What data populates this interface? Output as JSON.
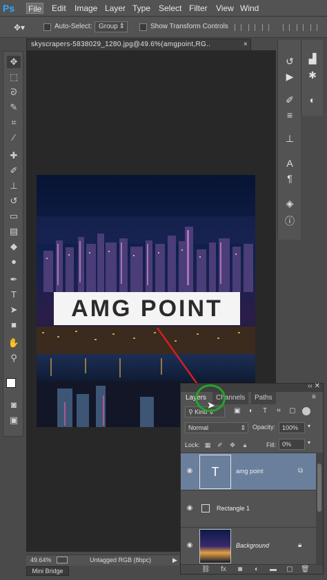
{
  "app": {
    "logo": "Ps"
  },
  "menu": {
    "items": [
      "File",
      "Edit",
      "Image",
      "Layer",
      "Type",
      "Select",
      "Filter",
      "View",
      "Wind"
    ]
  },
  "options": {
    "auto_select_label": "Auto-Select:",
    "auto_select_value": "Group",
    "transform_label": "Show Transform Controls"
  },
  "document": {
    "tab_title": "skyscrapers-5838029_1280.jpg@49.6%(amgpoint,RG..",
    "tab_close": "×",
    "banner_text": "AMG POINT"
  },
  "status": {
    "zoom": "49.64%",
    "profile": "Untagged RGB (8bpc)",
    "arrow": "▶"
  },
  "minibridge": {
    "label": "Mini Bridge"
  },
  "layers_panel": {
    "tabs": [
      "Layers",
      "Channels",
      "Paths"
    ],
    "kind_filter": "Kind",
    "blend_mode": "Normal",
    "opacity_label": "Opacity:",
    "opacity_value": "100%",
    "lock_label": "Lock:",
    "fill_label": "Fill:",
    "fill_value": "0%",
    "layers": [
      {
        "name": "amg point",
        "thumb": "T"
      },
      {
        "name": "Rectangle 1",
        "thumb": ""
      },
      {
        "name": "Background",
        "thumb": ""
      }
    ]
  },
  "colors": {
    "accent_ps": "#31a8ff",
    "selected_layer": "#6a7f9c",
    "annotation_circle": "#22a62b",
    "annotation_arrow": "#d12020"
  }
}
